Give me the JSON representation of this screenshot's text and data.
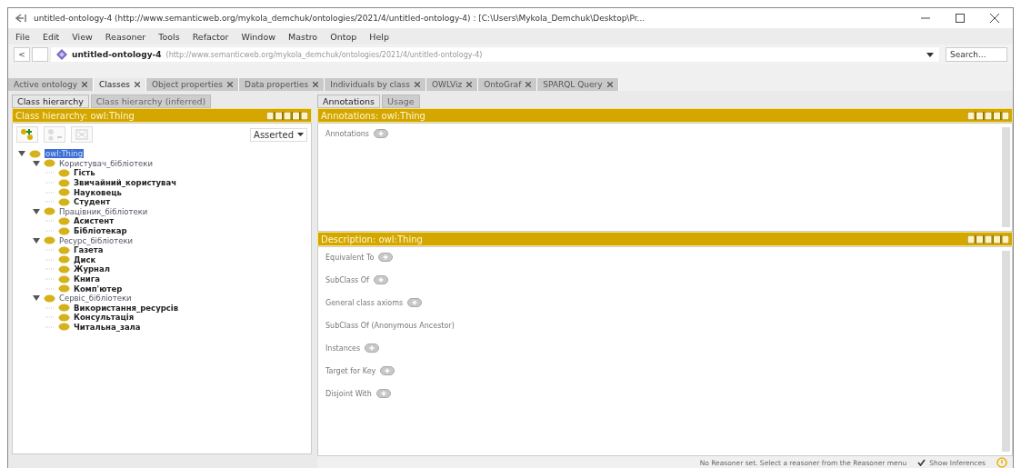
{
  "window": {
    "title": "untitled-ontology-4 (http://www.semanticweb.org/mykola_demchuk/ontologies/2021/4/untitled-ontology-4) : [C:\\Users\\Mykola_Demchuk\\Desktop\\Pr..."
  },
  "menu": [
    "File",
    "Edit",
    "View",
    "Reasoner",
    "Tools",
    "Refactor",
    "Window",
    "Mastro",
    "Ontop",
    "Help"
  ],
  "address_bar": {
    "back": "<",
    "ontology": "untitled-ontology-4",
    "iri": "(http://www.semanticweb.org/mykola_demchuk/ontologies/2021/4/untitled-ontology-4)",
    "search": {
      "placeholder": "Search..."
    }
  },
  "tabs": [
    {
      "label": "Active ontology",
      "selected": false
    },
    {
      "label": "Classes",
      "selected": true
    },
    {
      "label": "Object properties",
      "selected": false
    },
    {
      "label": "Data properties",
      "selected": false
    },
    {
      "label": "Individuals by class",
      "selected": false
    },
    {
      "label": "OWLViz",
      "selected": false
    },
    {
      "label": "OntoGraf",
      "selected": false
    },
    {
      "label": "SPARQL Query",
      "selected": false
    }
  ],
  "left": {
    "subtabs": [
      {
        "label": "Class hierarchy",
        "selected": true
      },
      {
        "label": "Class hierarchy (inferred)",
        "selected": false
      }
    ],
    "header": "Class hierarchy: owl:Thing",
    "mode": "Asserted",
    "tree": [
      {
        "label": "owl:Thing",
        "selected": true,
        "expanded": true,
        "children": [
          {
            "label": "Користувач_бібліотеки",
            "selected": false,
            "expanded": true,
            "children": [
              {
                "label": "Гість",
                "selected": false
              },
              {
                "label": "Звичайний_користувач",
                "selected": false
              },
              {
                "label": "Науковець",
                "selected": false
              },
              {
                "label": "Студент",
                "selected": false
              }
            ]
          },
          {
            "label": "Працівник_бібліотеки",
            "selected": false,
            "expanded": true,
            "children": [
              {
                "label": "Асистент",
                "selected": false
              },
              {
                "label": "Бібліотекар",
                "selected": false
              }
            ]
          },
          {
            "label": "Ресурс_бібліотеки",
            "selected": false,
            "expanded": true,
            "children": [
              {
                "label": "Газета",
                "selected": false
              },
              {
                "label": "Диск",
                "selected": false
              },
              {
                "label": "Журнал",
                "selected": false
              },
              {
                "label": "Книга",
                "selected": false
              },
              {
                "label": "Комп'ютер",
                "selected": false
              }
            ]
          },
          {
            "label": "Сервіс_бібліотеки",
            "selected": false,
            "expanded": true,
            "children": [
              {
                "label": "Використання_ресурсів",
                "selected": false
              },
              {
                "label": "Консультація",
                "selected": false
              },
              {
                "label": "Читальна_зала",
                "selected": false
              }
            ]
          }
        ]
      }
    ]
  },
  "right": {
    "subtabs": [
      {
        "label": "Annotations",
        "selected": true
      },
      {
        "label": "Usage",
        "selected": false
      }
    ],
    "annotations_header": "Annotations: owl:Thing",
    "annotations": [
      {
        "label": "Annotations",
        "addable": true
      }
    ],
    "description_header": "Description: owl:Thing",
    "description": [
      {
        "label": "Equivalent To",
        "addable": true
      },
      {
        "label": "SubClass Of",
        "addable": true
      },
      {
        "label": "General class axioms",
        "addable": true
      },
      {
        "label": "SubClass Of (Anonymous Ancestor)",
        "addable": false
      },
      {
        "label": "Instances",
        "addable": true
      },
      {
        "label": "Target for Key",
        "addable": true
      },
      {
        "label": "Disjoint With",
        "addable": true
      }
    ]
  },
  "status_bar": {
    "message": "No Reasoner set. Select a reasoner from the Reasoner menu",
    "show_inferences": {
      "label": "Show Inferences",
      "checked": true
    }
  }
}
